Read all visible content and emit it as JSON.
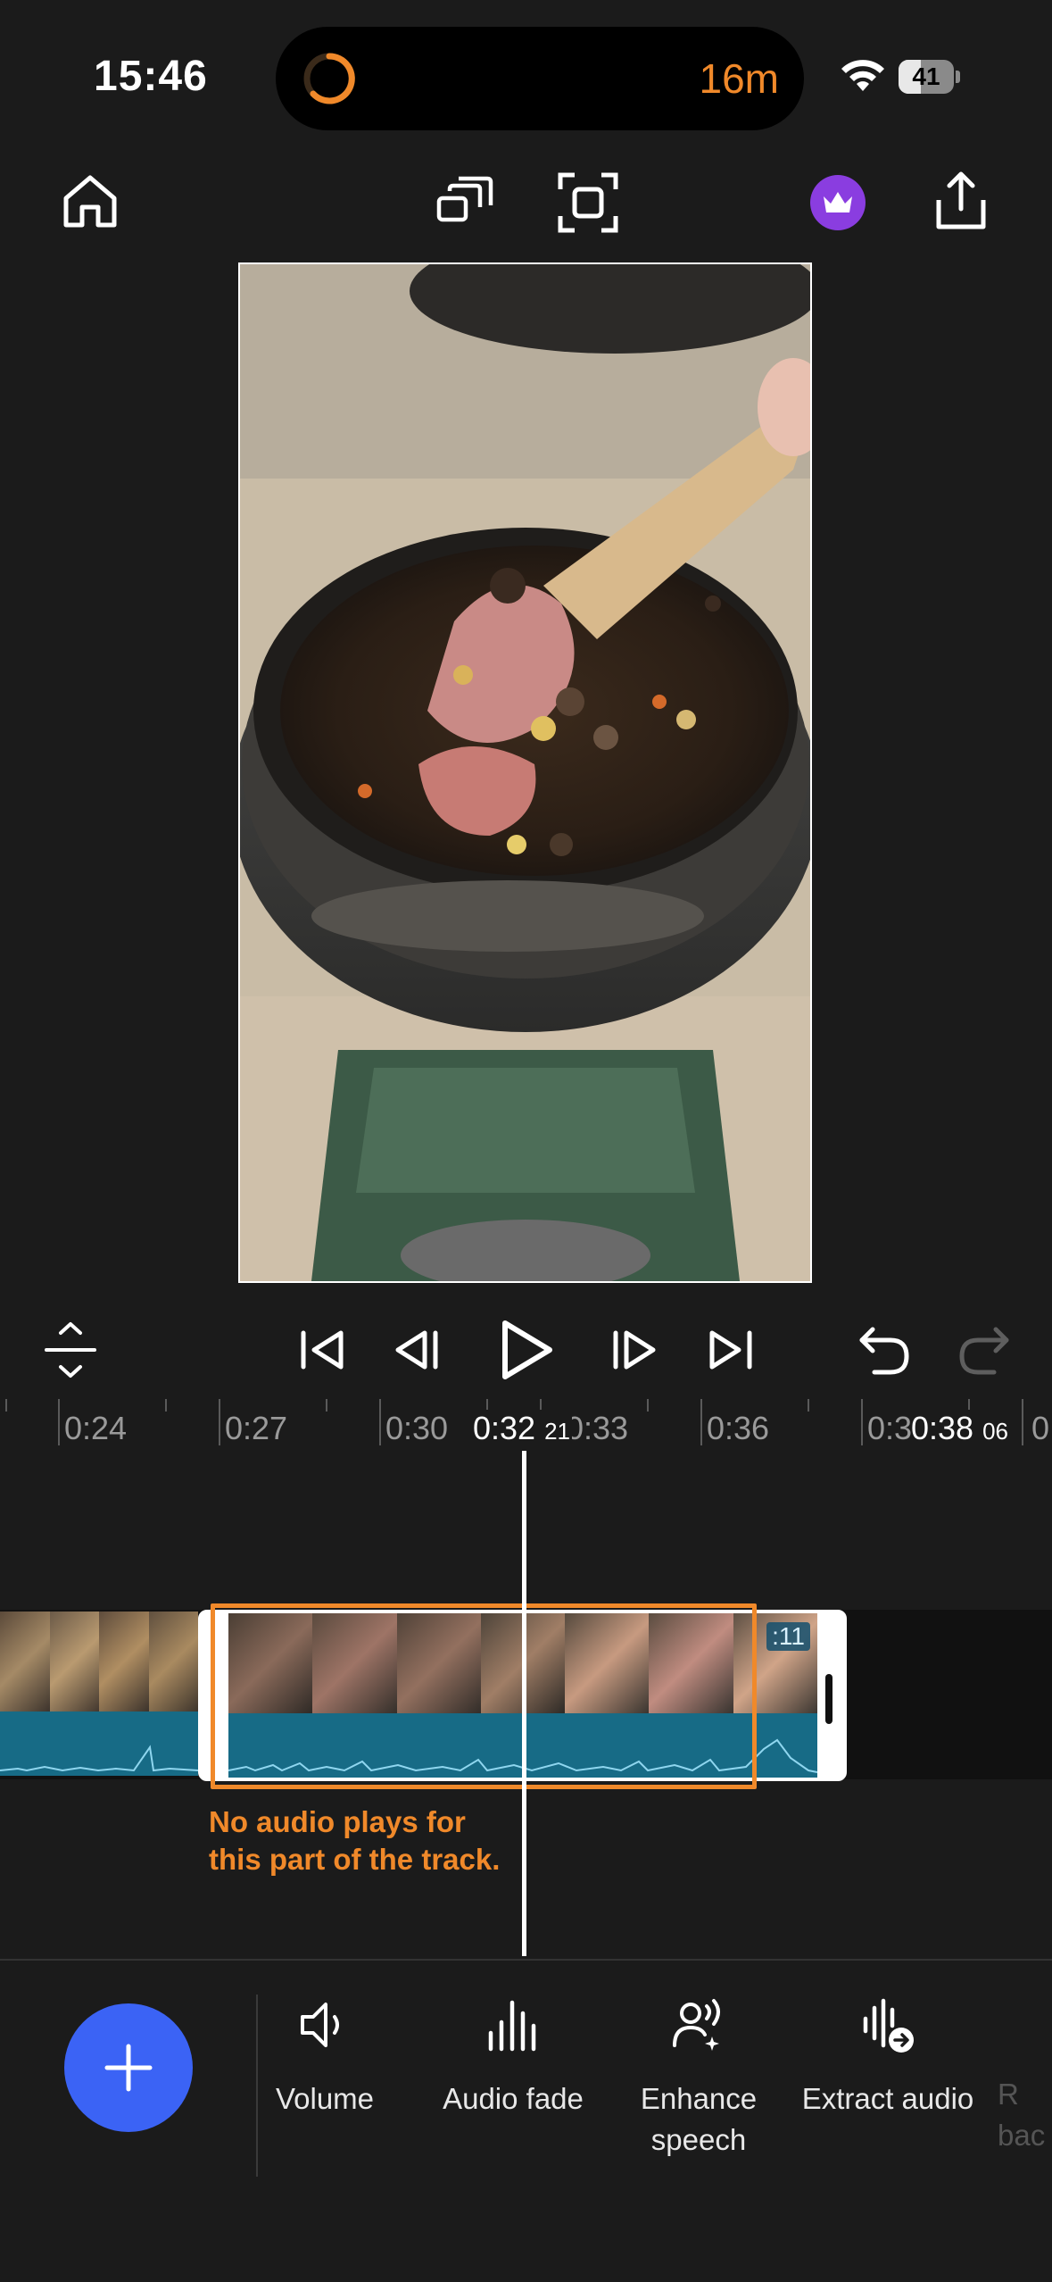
{
  "status_bar": {
    "time": "15:46",
    "activity_timer": "16m",
    "battery": "41",
    "battery_level": 0.41
  },
  "toolbar": {
    "icons": [
      "home-icon",
      "aspect-ratio-icon",
      "fit-frame-icon",
      "premium-crown-icon",
      "share-icon"
    ]
  },
  "preview": {
    "description_icon": "video-frame"
  },
  "playback": {
    "icons": [
      "collapse-icon",
      "skip-to-start-icon",
      "previous-frame-icon",
      "play-icon",
      "next-frame-icon",
      "skip-to-end-icon",
      "undo-icon",
      "redo-icon"
    ]
  },
  "ruler": {
    "labels": [
      "0:24",
      "0:27",
      "0:30",
      "0:33",
      "0:36",
      "0:3"
    ],
    "current_time": "0:32",
    "current_frames": "21",
    "end_time": "0:38",
    "end_frames": "06",
    "edge_label": "0"
  },
  "track": {
    "clip_duration_badge": ":11",
    "annotation_line1": "No audio plays for",
    "annotation_line2": "this part of the track."
  },
  "tools": [
    {
      "label": "Volume",
      "icon": "volume-icon"
    },
    {
      "label": "Audio fade",
      "icon": "audio-fade-icon"
    },
    {
      "label": "Enhance\nspeech",
      "label_line1": "Enhance",
      "label_line2": "speech",
      "icon": "enhance-speech-icon"
    },
    {
      "label": "Extract audio",
      "icon": "extract-audio-icon"
    },
    {
      "label_line1": "R",
      "label_line2": "bac",
      "icon": "remove-background-icon"
    }
  ],
  "colors": {
    "accent_orange": "#f0892a",
    "fab_blue": "#3b63f5",
    "premium_purple": "#8a3de0",
    "waveform_teal": "#176b86",
    "background": "#1b1b1b"
  }
}
